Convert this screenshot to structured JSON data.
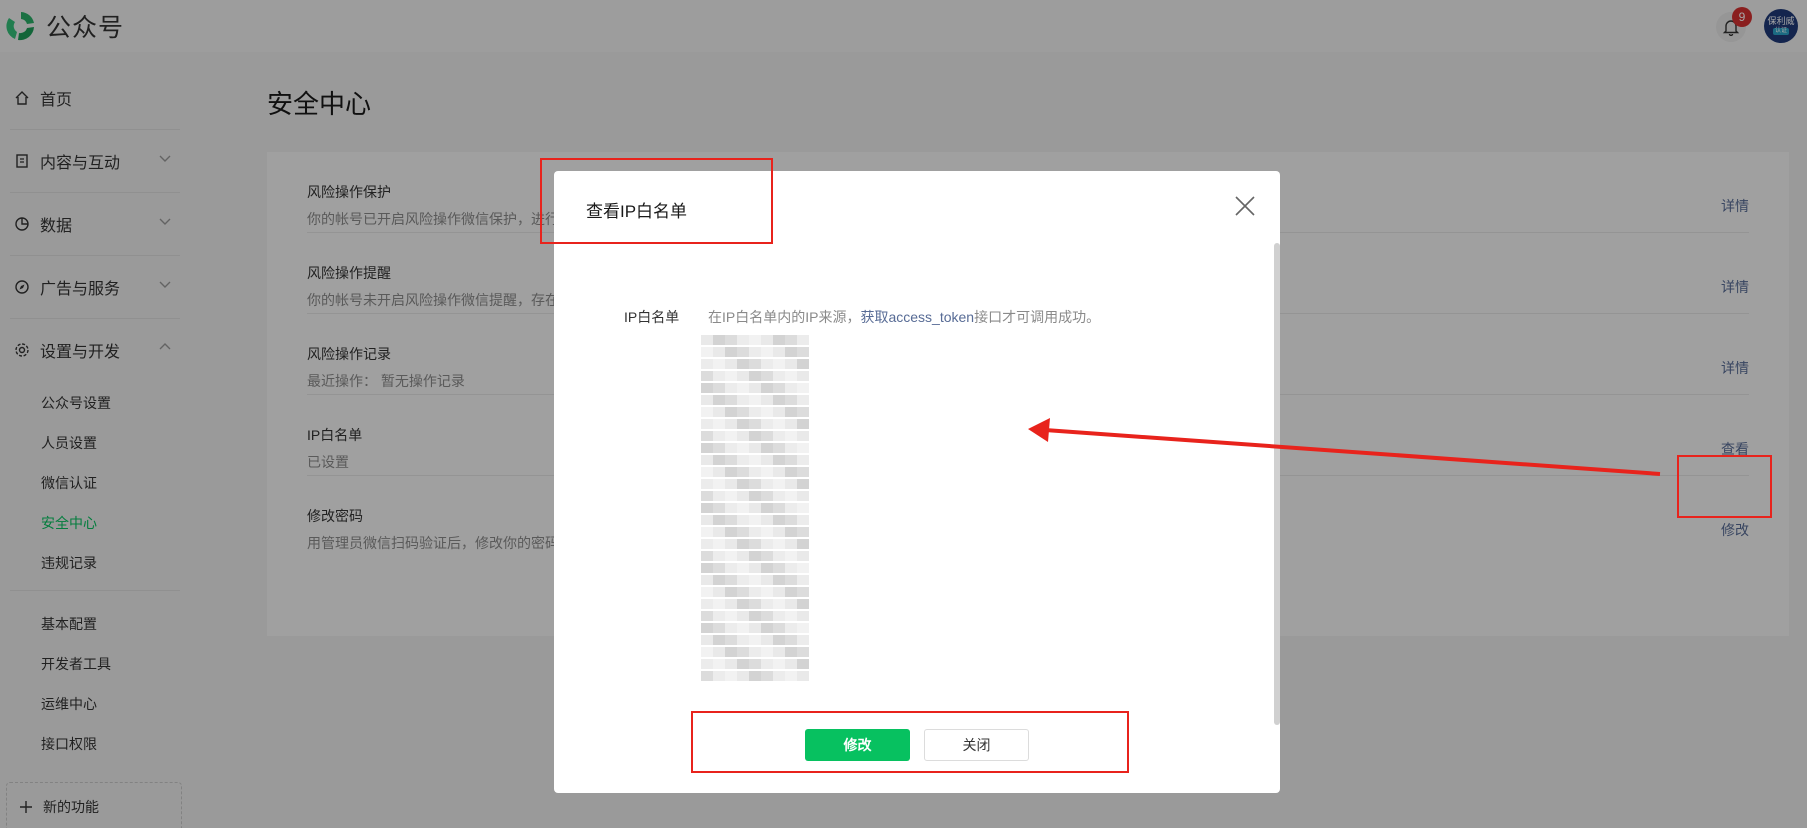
{
  "app": {
    "name": "公众号"
  },
  "header": {
    "notification_count": "9",
    "avatar_text": "保利威",
    "avatar_tag": "认证"
  },
  "sidebar": {
    "items": [
      {
        "label": "首页"
      },
      {
        "label": "内容与互动"
      },
      {
        "label": "数据"
      },
      {
        "label": "广告与服务"
      },
      {
        "label": "设置与开发"
      }
    ],
    "sub_items_1": [
      {
        "label": "公众号设置"
      },
      {
        "label": "人员设置"
      },
      {
        "label": "微信认证"
      },
      {
        "label": "安全中心"
      },
      {
        "label": "违规记录"
      }
    ],
    "sub_items_2": [
      {
        "label": "基本配置"
      },
      {
        "label": "开发者工具"
      },
      {
        "label": "运维中心"
      },
      {
        "label": "接口权限"
      }
    ],
    "new_feature": "新的功能"
  },
  "main": {
    "title": "安全中心",
    "rows": [
      {
        "title": "风险操作保护",
        "desc": "你的帐号已开启风险操作微信保护，进行",
        "action": "详情"
      },
      {
        "title": "风险操作提醒",
        "desc": "你的帐号未开启风险操作微信提醒，存在",
        "action": "详情"
      },
      {
        "title": "风险操作记录",
        "desc": "最近操作：    暂无操作记录",
        "action": "详情"
      },
      {
        "title": "IP白名单",
        "desc": "已设置",
        "action": "查看"
      },
      {
        "title": "修改密码",
        "desc": "用管理员微信扫码验证后，修改你的密码",
        "action": "修改"
      }
    ]
  },
  "dialog": {
    "title": "查看IP白名单",
    "field_label": "IP白名单",
    "hint_pre": "在IP白名单内的IP来源，",
    "hint_link": "获取access_token",
    "hint_post": "接口才可调用成功。",
    "btn_primary": "修改",
    "btn_close": "关闭"
  },
  "colors": {
    "brand_green": "#07c160",
    "link_blue": "#576b95",
    "annotation_red": "#e8231c"
  }
}
